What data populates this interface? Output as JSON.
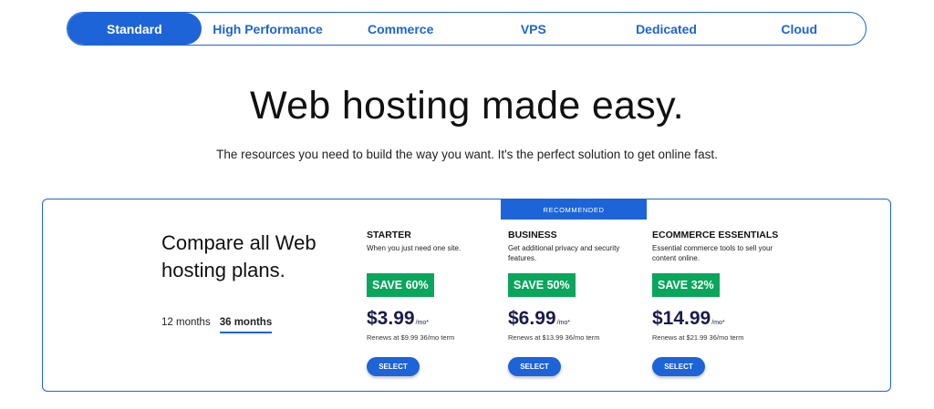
{
  "tabs": [
    {
      "label": "Standard",
      "active": true
    },
    {
      "label": "High Performance",
      "active": false
    },
    {
      "label": "Commerce",
      "active": false
    },
    {
      "label": "VPS",
      "active": false
    },
    {
      "label": "Dedicated",
      "active": false
    },
    {
      "label": "Cloud",
      "active": false
    }
  ],
  "hero": {
    "title": "Web hosting made easy.",
    "subtitle": "The resources you need to build the way you want. It's the perfect solution to get online fast."
  },
  "compare": {
    "title": "Compare all Web hosting plans.",
    "terms": [
      {
        "label": "12 months",
        "active": false
      },
      {
        "label": "36 months",
        "active": true
      }
    ],
    "recommended_label": "RECOMMENDED"
  },
  "plans": [
    {
      "name": "STARTER",
      "description": "When you just need one site.",
      "save": "SAVE 60%",
      "price": "$3.99",
      "per": "/mo*",
      "renew": "Renews at $9.99 36/mo term",
      "cta": "SELECT"
    },
    {
      "name": "BUSINESS",
      "description": "Get additional privacy and security features.",
      "save": "SAVE 50%",
      "price": "$6.99",
      "per": "/mo*",
      "renew": "Renews at $13.99 36/mo term",
      "cta": "SELECT"
    },
    {
      "name": "ECOMMERCE ESSENTIALS",
      "description": "Essential commerce tools to sell your content online.",
      "save": "SAVE 32%",
      "price": "$14.99",
      "per": "/mo*",
      "renew": "Renews at $21.99 36/mo term",
      "cta": "SELECT"
    }
  ],
  "colors": {
    "primary": "#1d64d8",
    "save_badge": "#09a65b",
    "price_text": "#1b1b4a"
  }
}
